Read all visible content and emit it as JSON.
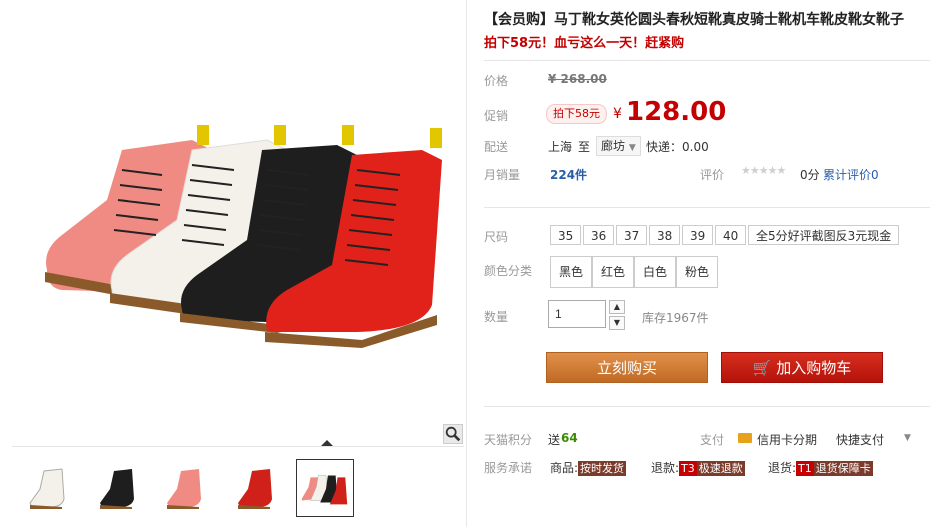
{
  "product": {
    "title": "【会员购】马丁靴女英伦圆头春秋短靴真皮骑士靴机车靴皮靴女靴子",
    "promo_line": "拍下58元！血亏这么一天！赶紧购"
  },
  "price": {
    "label": "价格",
    "original": "¥ 268.00",
    "promo_label": "促销",
    "promo_badge": "拍下58元",
    "currency": "¥",
    "current": "128.00"
  },
  "shipping": {
    "label": "配送",
    "from": "上海",
    "to_word": "至",
    "destination": "廊坊",
    "express": "快递：0.00"
  },
  "sales": {
    "label": "月销量",
    "count": "224件",
    "rating_label": "评价",
    "rating_value": "0分",
    "review_link": "累计评价0"
  },
  "sizes": {
    "label": "尺码",
    "options": [
      "35",
      "36",
      "37",
      "38",
      "39",
      "40",
      "全5分好评截图反3元现金"
    ]
  },
  "colors": {
    "label": "颜色分类",
    "options": [
      "黑色",
      "红色",
      "白色",
      "粉色"
    ]
  },
  "quantity": {
    "label": "数量",
    "value": "1",
    "stock": "库存1967件"
  },
  "actions": {
    "buy_now": "立刻购买",
    "add_cart": "加入购物车"
  },
  "points": {
    "label": "天猫积分",
    "prefix": "送",
    "value": "64"
  },
  "payment": {
    "label": "支付",
    "card_installment": "信用卡分期",
    "quick_pay": "快捷支付"
  },
  "service": {
    "label": "服务承诺",
    "goods_label": "商品:",
    "goods_tag": "按时发货",
    "refund_label": "退款:",
    "refund_code": "T3",
    "refund_tag": "极速退款",
    "return_label": "退货:",
    "return_code": "T1",
    "return_tag": "退货保障卡"
  },
  "colors_theme": {
    "price_red": "#c40000",
    "buy_button": "#c9772f",
    "cart_button": "#c4170c"
  }
}
